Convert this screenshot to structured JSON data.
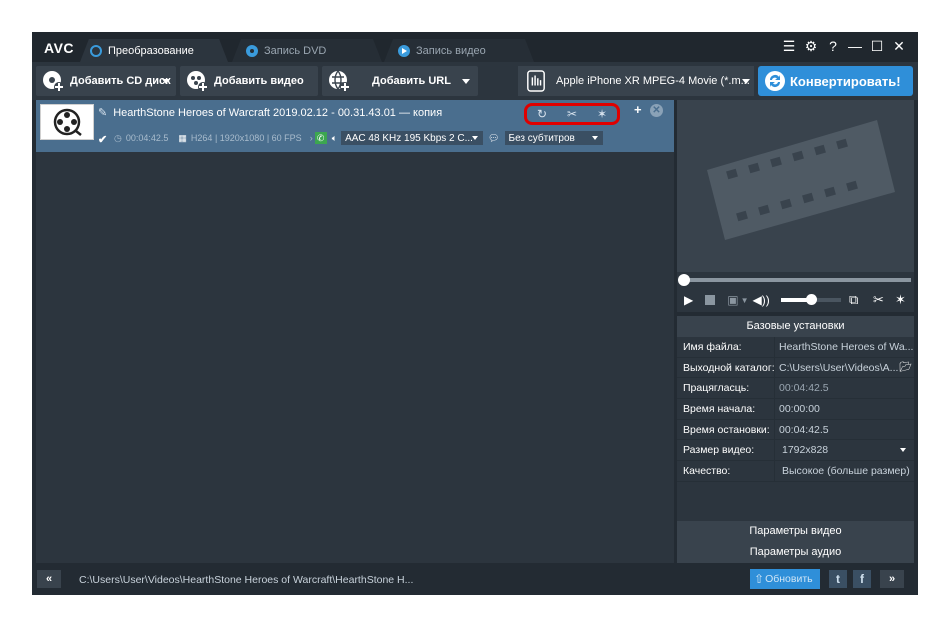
{
  "app": {
    "logo": "AVC",
    "tabs": [
      {
        "label": "Преобразование",
        "icon": "refresh-icon"
      },
      {
        "label": "Запись DVD",
        "icon": "disc-icon"
      },
      {
        "label": "Запись видео",
        "icon": "record-icon"
      }
    ],
    "window_buttons": {
      "menu": "☰",
      "settings": "⚙",
      "help": "?",
      "minimize": "—",
      "maximize": "☐",
      "close": "✕"
    }
  },
  "toolbar": {
    "add_cd": "Добавить CD диск",
    "add_video": "Добавить видео",
    "add_url": "Добавить URL",
    "profile": "Apple iPhone XR MPEG-4 Movie (*.m...",
    "convert": "Конвертировать!",
    "accent_color": "#2f8fd9"
  },
  "file": {
    "name": "HearthStone  Heroes of Warcraft 2019.02.12 - 00.31.43.01 — копия",
    "duration": "00:04:42.5",
    "video_info": "H264 | 1920x1080 | 60 FPS",
    "audio_track": "AAC 48 KHz 195 Kbps 2 C...",
    "subtitles": "Без субтитров",
    "checked": true
  },
  "settings": {
    "header": "Базовые установки",
    "rows": [
      {
        "key": "Имя файла:",
        "value": "HearthStone  Heroes of Wa..."
      },
      {
        "key": "Выходной каталог:",
        "value": "C:\\Users\\User\\Videos\\A..."
      },
      {
        "key": "Працягласць:",
        "value": "00:04:42.5"
      },
      {
        "key": "Время начала:",
        "value": "00:00:00"
      },
      {
        "key": "Время остановки:",
        "value": "00:04:42.5"
      },
      {
        "key": "Размер видео:",
        "value": "1792x828"
      },
      {
        "key": "Качество:",
        "value": "Высокое (больше размер)"
      }
    ],
    "video_params": "Параметры видео",
    "audio_params": "Параметры аудио"
  },
  "status": {
    "path": "C:\\Users\\User\\Videos\\HearthStone  Heroes of Warcraft\\HearthStone  H...",
    "update": "Обновить",
    "highlight_color": "#e00000"
  }
}
